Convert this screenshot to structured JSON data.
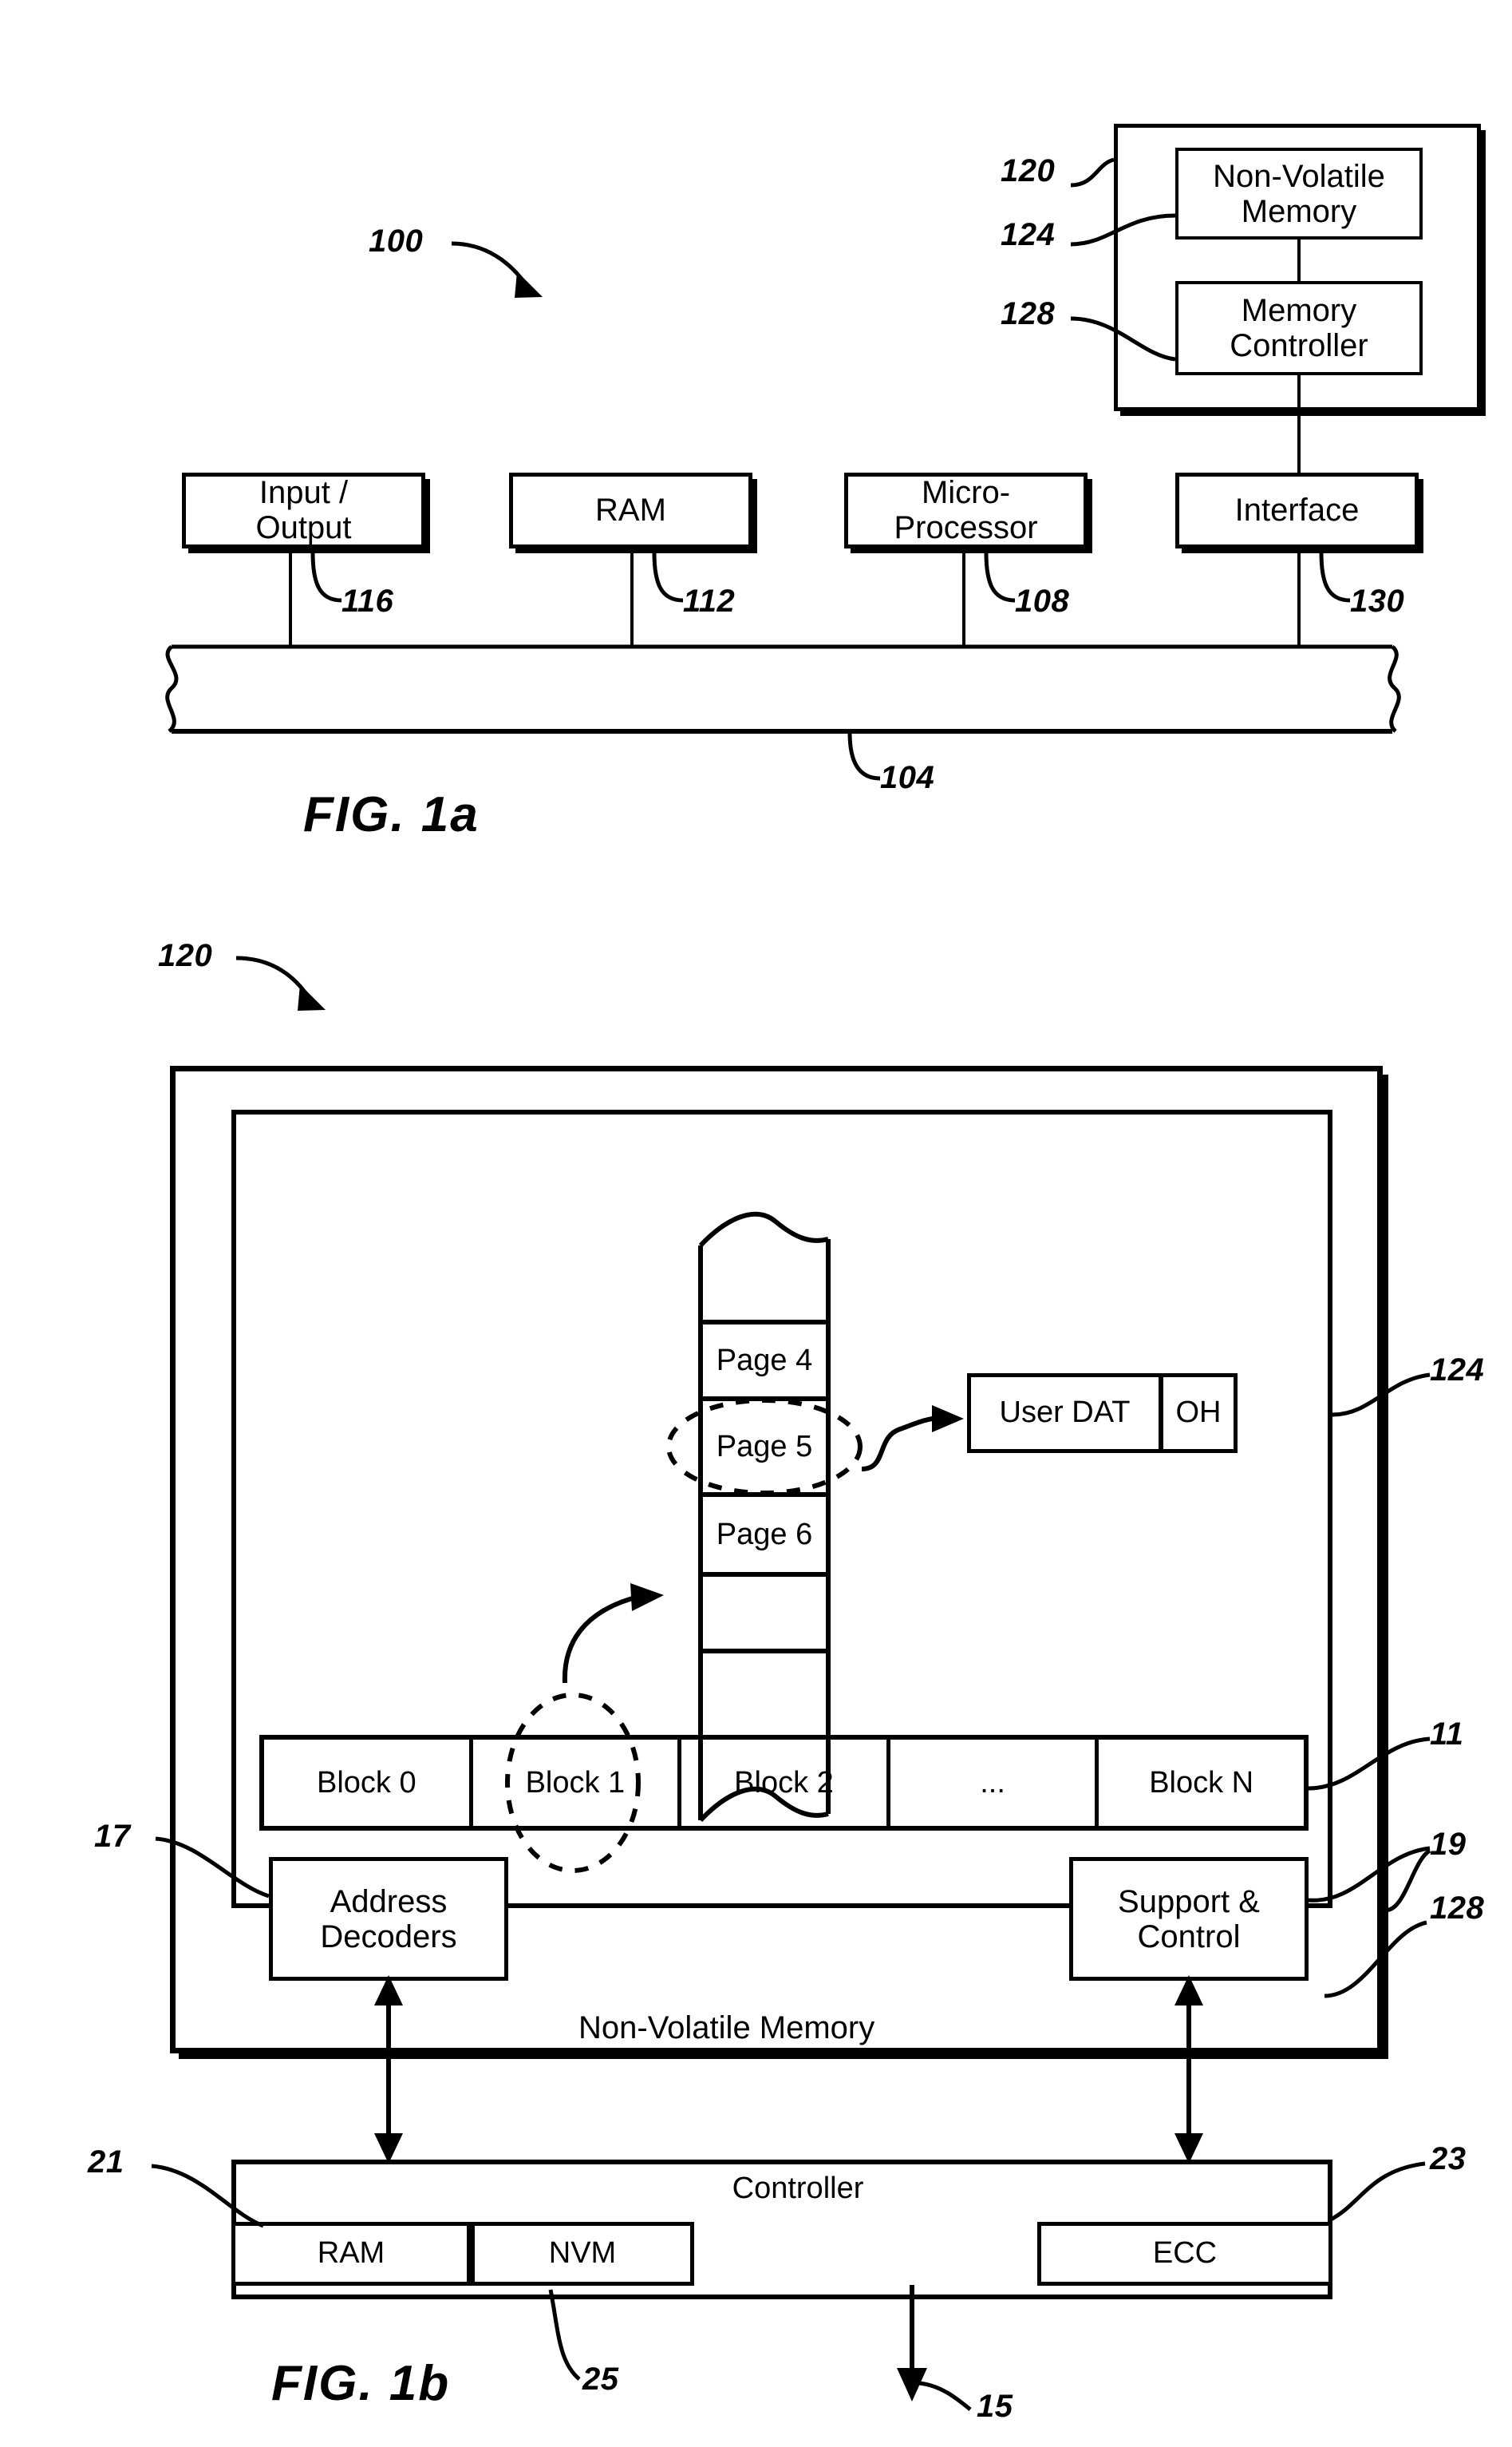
{
  "figure_1a": {
    "fig_label": "FIG. 1a",
    "system_ref": "100",
    "bus_ref": "104",
    "memory_system": {
      "outer_ref": "120",
      "nvm_ref": "124",
      "controller_ref": "128",
      "nvm_label": "Non-Volatile\nMemory",
      "controller_label": "Memory\nController"
    },
    "peripherals": [
      {
        "label": "Input /\nOutput",
        "ref": "116"
      },
      {
        "label": "RAM",
        "ref": "112"
      },
      {
        "label": "Micro-\nProcessor",
        "ref": "108"
      },
      {
        "label": "Interface",
        "ref": "130"
      }
    ]
  },
  "figure_1b": {
    "fig_label": "FIG. 1b",
    "system_ref": "120",
    "nvm_chip_ref": "124",
    "block_array_ref": "11",
    "address_decoders_ref": "17",
    "support_control_ref": "19",
    "controller_ref": "128",
    "controller_ram_ref": "21",
    "controller_ecc_ref": "23",
    "controller_nvm_ref": "25",
    "host_bus_ref": "15",
    "nvm_inner_label": "Non-Volatile Memory",
    "pages": [
      {
        "label": "Page 4",
        "highlighted": false
      },
      {
        "label": "Page 5",
        "highlighted": true
      },
      {
        "label": "Page 6",
        "highlighted": false
      }
    ],
    "page_detail": {
      "user_data_label": "User DAT",
      "overhead_label": "OH"
    },
    "blocks": [
      {
        "label": "Block 0",
        "highlighted": false
      },
      {
        "label": "Block 1",
        "highlighted": true
      },
      {
        "label": "Block 2",
        "highlighted": false
      },
      {
        "label": "...",
        "highlighted": false
      },
      {
        "label": "Block N",
        "highlighted": false
      }
    ],
    "address_decoders_label": "Address\nDecoders",
    "support_control_label": "Support &\nControl",
    "controller_label": "Controller",
    "controller_parts": [
      {
        "label": "RAM"
      },
      {
        "label": "NVM"
      },
      {
        "label": "ECC"
      }
    ]
  },
  "colors": {
    "ink": "#000000",
    "paper": "#ffffff"
  }
}
